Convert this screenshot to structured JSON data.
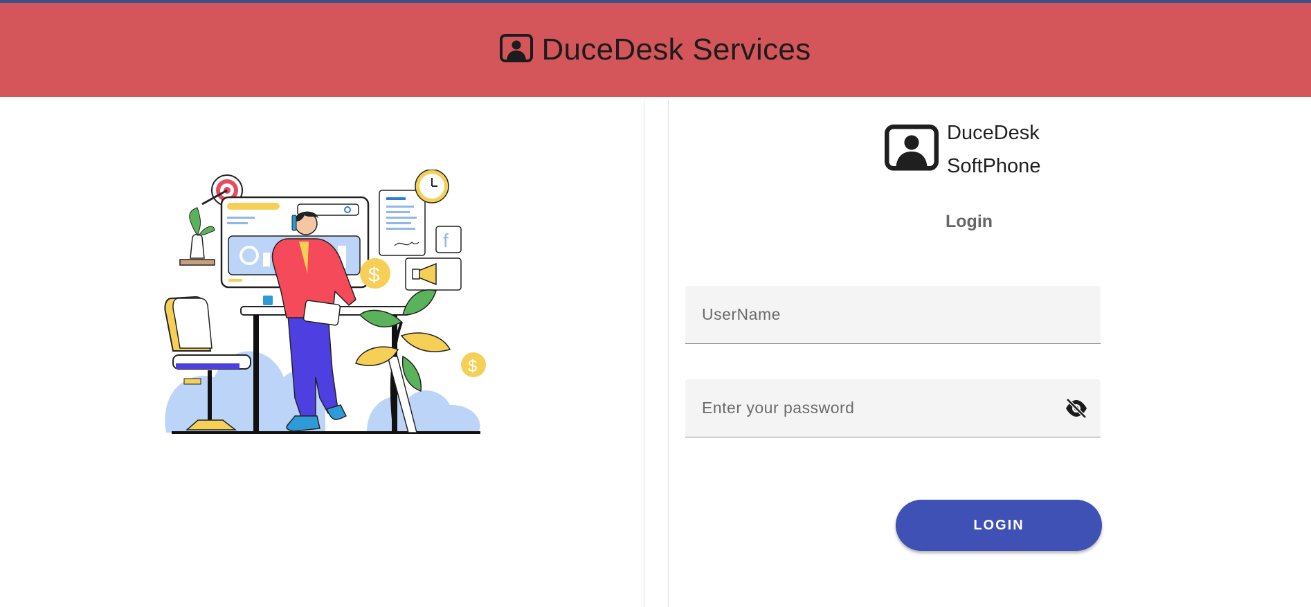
{
  "header": {
    "title": "DuceDesk Services",
    "icon": "contact-icon",
    "background": "#d4565a"
  },
  "brand": {
    "line1": "DuceDesk",
    "line2": "SoftPhone",
    "icon": "contact-icon"
  },
  "login": {
    "heading": "Login",
    "username_placeholder": "UserName",
    "password_placeholder": "Enter your password",
    "password_toggle_icon": "eye-off-icon",
    "button_label": "LOGIN",
    "button_color": "#3f51b5"
  },
  "illustration": {
    "subject": "office-worker-illustration"
  }
}
